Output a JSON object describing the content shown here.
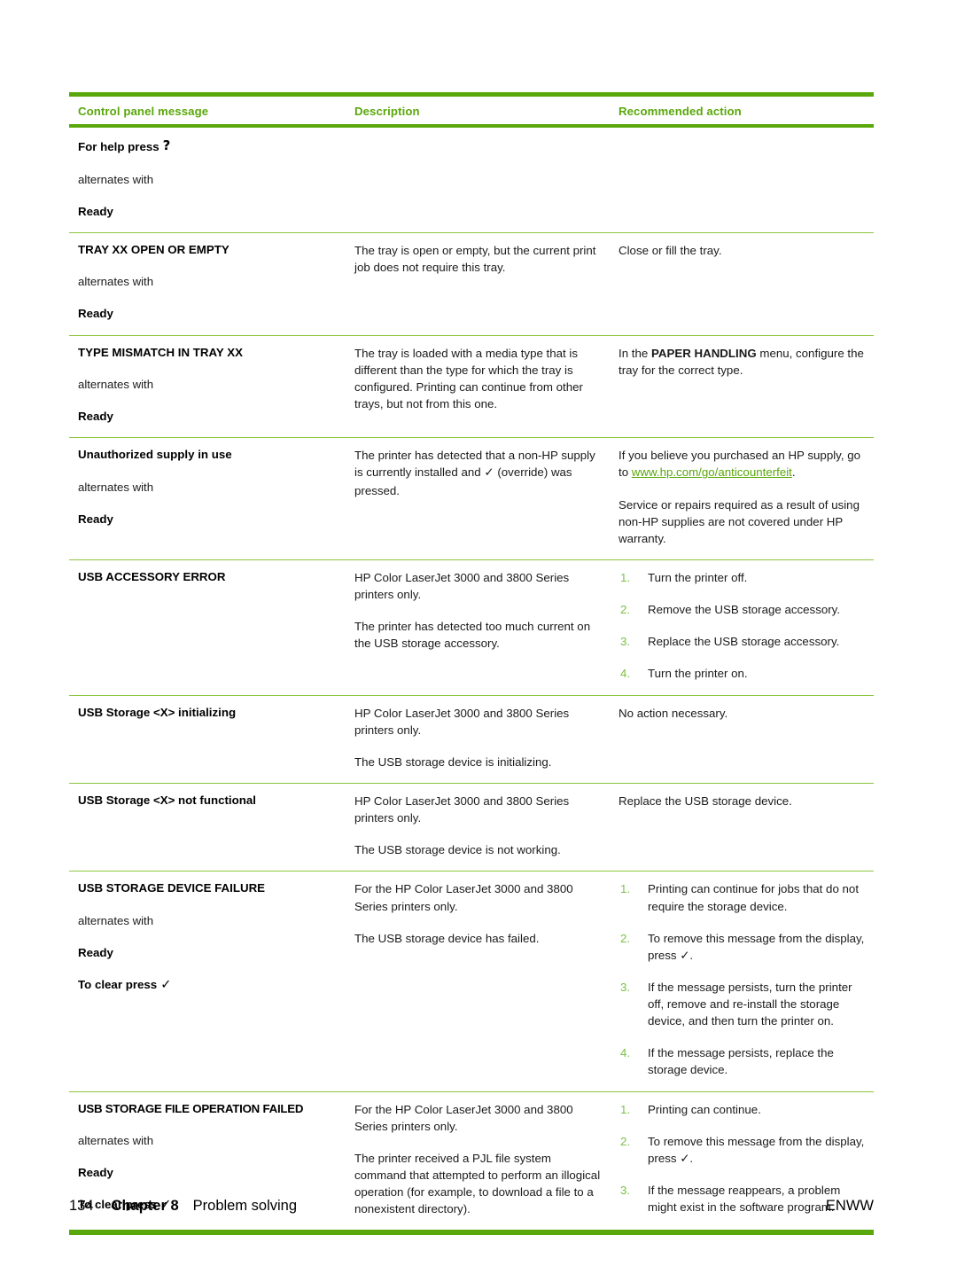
{
  "page": {
    "number": "134",
    "chapter": "Chapter 8",
    "section": "Problem solving",
    "locale_code": "ENWW"
  },
  "colors": {
    "accent_green": "#5aa70b",
    "rule_green": "#8cc63e",
    "step_number_green": "#7ac143",
    "text_black": "#000000"
  },
  "table": {
    "headers": {
      "col1": "Control panel message",
      "col2": "Description",
      "col3": "Recommended action"
    },
    "rows": [
      {
        "message": {
          "title": "For help press",
          "title_glyph": "?",
          "alternates_label": "alternates with",
          "sub": "Ready"
        },
        "description": {
          "paragraphs": []
        },
        "action": {
          "paragraphs": [],
          "steps": []
        }
      },
      {
        "message": {
          "title": "TRAY XX OPEN OR EMPTY",
          "alternates_label": "alternates with",
          "sub": "Ready"
        },
        "description": {
          "paragraphs": [
            "The tray is open or empty, but the current print job does not require this tray."
          ]
        },
        "action": {
          "paragraphs": [
            "Close or fill the tray."
          ],
          "steps": []
        }
      },
      {
        "message": {
          "title": "TYPE MISMATCH IN TRAY XX",
          "alternates_label": "alternates with",
          "sub": "Ready"
        },
        "description": {
          "paragraphs": [
            "The tray is loaded with a media type that is different than the type for which the tray is configured. Printing can continue from other trays, but not from this one."
          ]
        },
        "action": {
          "paragraphs_rich": [
            {
              "pre": "In the ",
              "bold": "PAPER HANDLING",
              "post": " menu, configure the tray for the correct type."
            }
          ],
          "steps": []
        }
      },
      {
        "message": {
          "title": "Unauthorized supply in use",
          "alternates_label": "alternates with",
          "sub": "Ready"
        },
        "description": {
          "rich": {
            "pre": "The printer has detected that a non-HP supply is currently installed and ",
            "glyph": "✓",
            "post": " (override) was pressed."
          }
        },
        "action": {
          "link_paragraph": {
            "pre": "If you believe you purchased an HP supply, go to ",
            "link_text": "www.hp.com/go/anticounterfeit",
            "post": "."
          },
          "paragraphs": [
            "Service or repairs required as a result of using non-HP supplies are not covered under HP warranty."
          ],
          "steps": []
        }
      },
      {
        "message": {
          "title": "USB ACCESSORY ERROR"
        },
        "description": {
          "paragraphs": [
            "HP Color LaserJet 3000 and 3800 Series printers only.",
            "The printer has detected too much current on the USB storage accessory."
          ]
        },
        "action": {
          "steps": [
            "Turn the printer off.",
            "Remove the USB storage accessory.",
            "Replace the USB storage accessory.",
            "Turn the printer on."
          ]
        }
      },
      {
        "message": {
          "title": "USB Storage <X> initializing"
        },
        "description": {
          "paragraphs": [
            "HP Color LaserJet 3000 and 3800 Series printers only.",
            "The USB storage device is initializing."
          ]
        },
        "action": {
          "paragraphs": [
            "No action necessary."
          ],
          "steps": []
        }
      },
      {
        "message": {
          "title": "USB Storage <X> not functional"
        },
        "description": {
          "paragraphs": [
            "HP Color LaserJet 3000 and 3800 Series printers only.",
            "The USB storage device is not working."
          ]
        },
        "action": {
          "paragraphs": [
            "Replace the USB storage device."
          ],
          "steps": []
        }
      },
      {
        "message": {
          "title": "USB STORAGE DEVICE FAILURE",
          "alternates_label": "alternates with",
          "sub": "Ready",
          "sub2": "To clear press",
          "sub2_glyph": "✓"
        },
        "description": {
          "paragraphs": [
            "For the HP Color LaserJet 3000 and 3800 Series printers only.",
            "The USB storage device has failed."
          ]
        },
        "action": {
          "steps": [
            "Printing can continue for jobs that do not require the storage device.",
            "To remove this message from the display, press ✓.",
            "If the message persists, turn the printer off, remove and re-install the storage device, and then turn the printer on.",
            "If the message persists, replace the storage device."
          ]
        }
      },
      {
        "message": {
          "title": "USB STORAGE FILE OPERATION FAILED",
          "alternates_label": "alternates with",
          "sub": "Ready",
          "sub2": "To clear press",
          "sub2_glyph": "✓"
        },
        "description": {
          "paragraphs": [
            "For the HP Color LaserJet 3000 and 3800 Series printers only.",
            "The printer received a PJL file system command that attempted to perform an illogical operation (for example, to download a file to a nonexistent directory)."
          ]
        },
        "action": {
          "steps": [
            "Printing can continue.",
            "To remove this message from the display, press ✓.",
            "If the message reappears, a problem might exist in the software program."
          ]
        }
      }
    ]
  }
}
